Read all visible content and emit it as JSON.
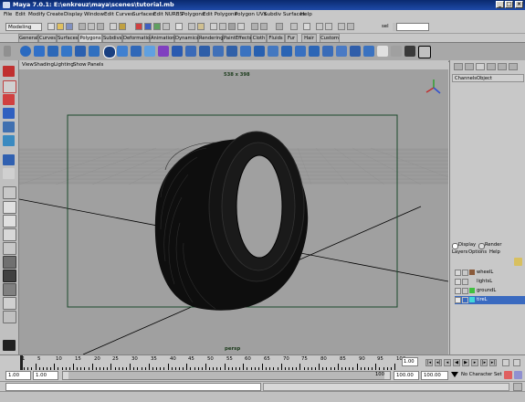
{
  "window": {
    "title": "Maya 7.0.1: E:\\enkreuz\\maya\\scenes\\tutorial.mb"
  },
  "menubar": {
    "items": [
      "File",
      "Edit",
      "Modify",
      "Create",
      "Display",
      "Window",
      "Edit Curves",
      "Surfaces",
      "Edit NURBS",
      "Polygons",
      "Edit Polygons",
      "Polygon UVs",
      "Subdiv Surfaces",
      "Help"
    ]
  },
  "statusline": {
    "mode_value": "Modeling",
    "sel_label": "sel"
  },
  "shelf": {
    "tabs": [
      "General",
      "Curves",
      "Surfaces",
      "Polygons",
      "Subdivs",
      "Deformation",
      "Animation",
      "Dynamics",
      "Rendering",
      "PaintEffects",
      "Cloth",
      "Fluids",
      "Fur",
      "Hair",
      "Custom"
    ],
    "active_tab": "Polygons"
  },
  "viewport": {
    "menu": [
      "View",
      "Shading",
      "Lighting",
      "Show",
      "Panels"
    ],
    "resolution_label": "538 x 398",
    "camera_label": "persp"
  },
  "channelbox": {
    "menu": [
      "Channels",
      "Object"
    ]
  },
  "layereditor": {
    "mode_display": "Display",
    "mode_render": "Render",
    "menu": [
      "Layers",
      "Options",
      "Help"
    ],
    "layers": [
      {
        "name": "wheelL",
        "color": "#8a5a3a",
        "selected": false
      },
      {
        "name": "lightsL",
        "color": "#c8c8c8",
        "selected": false
      },
      {
        "name": "groundL",
        "color": "#40c040",
        "selected": false
      },
      {
        "name": "tireL",
        "color": "#40d8d8",
        "selected": true
      }
    ]
  },
  "timeslider": {
    "ticks": [
      "1",
      "5",
      "10",
      "15",
      "20",
      "25",
      "30",
      "35",
      "40",
      "45",
      "50",
      "55",
      "60",
      "65",
      "70",
      "75",
      "80",
      "85",
      "90",
      "95",
      "100"
    ],
    "current_frame": "1.00"
  },
  "rangeslider": {
    "start_value": "1.00",
    "playback_start": "1.00",
    "playback_end_inner": "100",
    "playback_end": "100.00",
    "end_value": "100.00",
    "character_set": "No Character Set"
  }
}
